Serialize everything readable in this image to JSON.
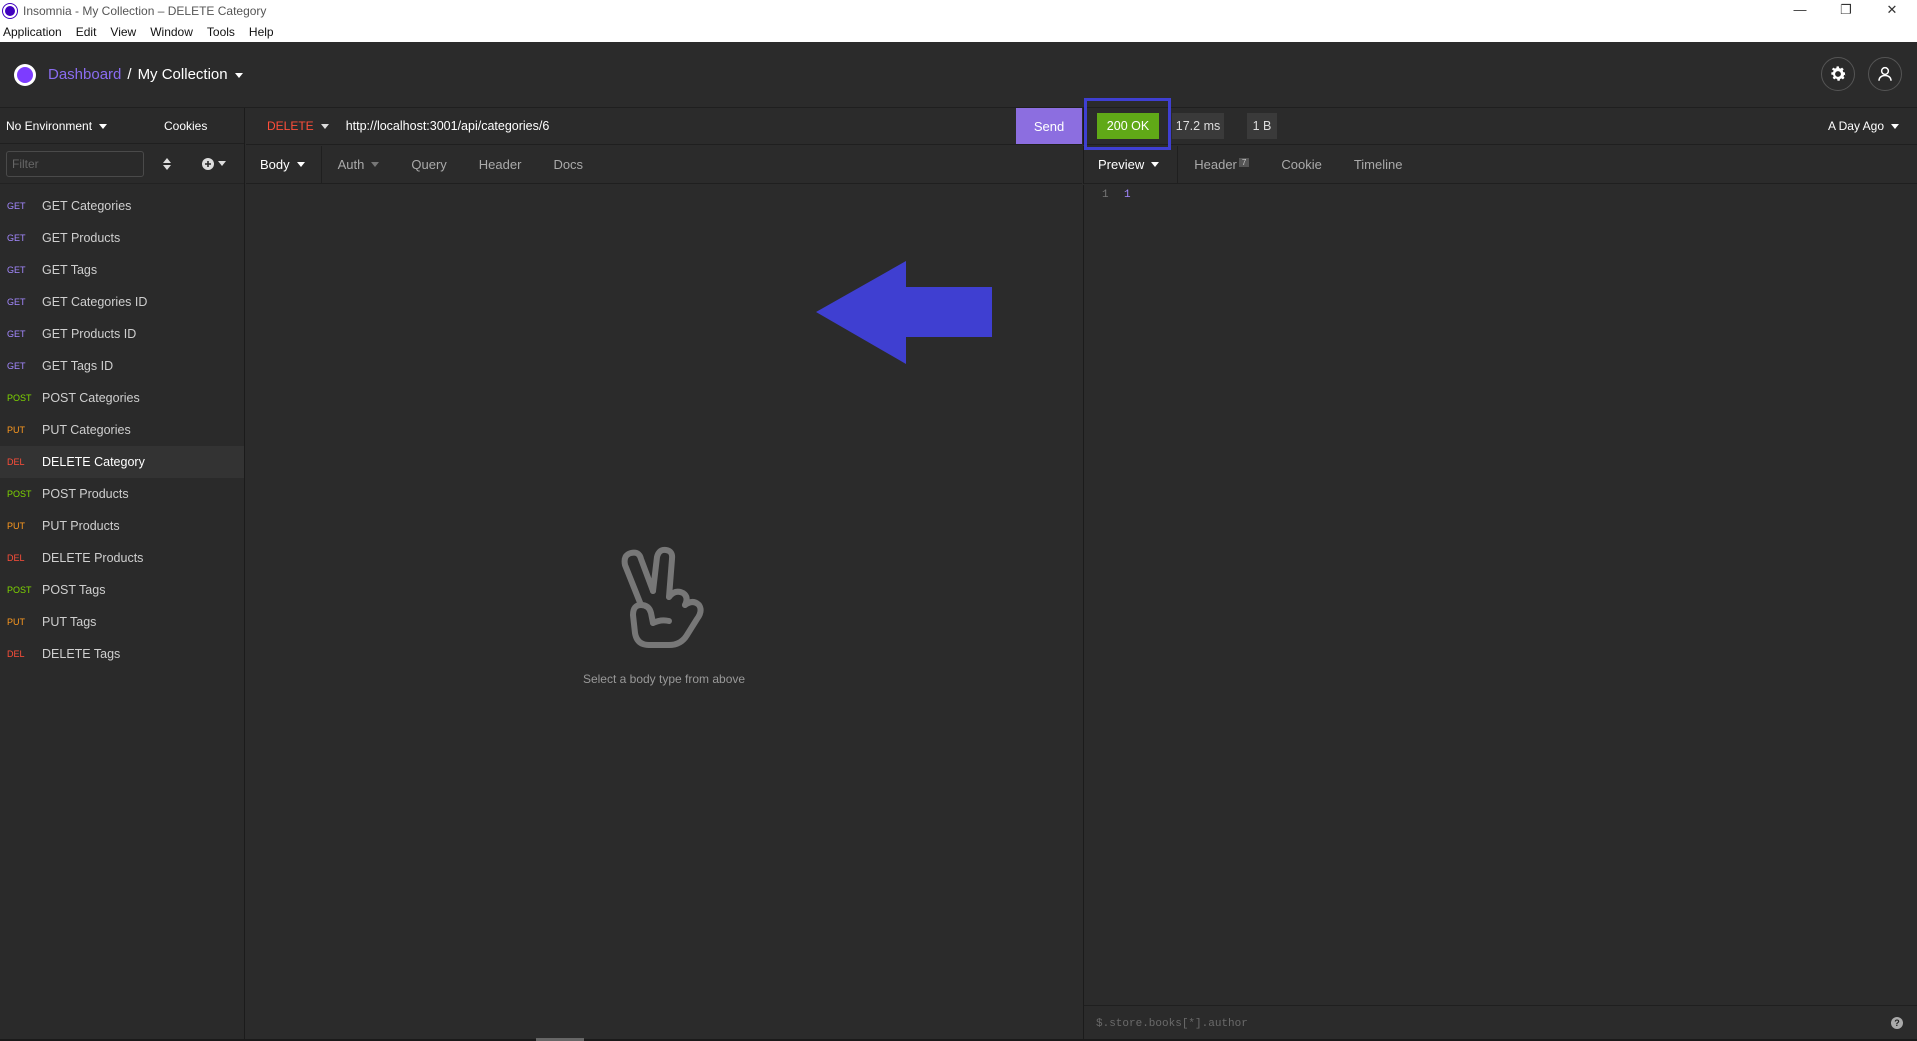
{
  "window": {
    "title": "Insomnia - My Collection – DELETE Category",
    "controls": [
      "—",
      "❐",
      "✕"
    ]
  },
  "menu": [
    "Application",
    "Edit",
    "View",
    "Window",
    "Tools",
    "Help"
  ],
  "header": {
    "breadcrumb_dashboard": "Dashboard",
    "breadcrumb_sep": "/",
    "breadcrumb_collection": "My Collection"
  },
  "sidebar": {
    "environment": "No Environment",
    "cookies": "Cookies",
    "filter_placeholder": "Filter",
    "requests": [
      {
        "method": "GET",
        "name": "GET Categories"
      },
      {
        "method": "GET",
        "name": "GET Products"
      },
      {
        "method": "GET",
        "name": "GET Tags"
      },
      {
        "method": "GET",
        "name": "GET Categories ID"
      },
      {
        "method": "GET",
        "name": "GET Products ID"
      },
      {
        "method": "GET",
        "name": "GET Tags ID"
      },
      {
        "method": "POST",
        "name": "POST Categories"
      },
      {
        "method": "PUT",
        "name": "PUT Categories"
      },
      {
        "method": "DEL",
        "name": "DELETE Category"
      },
      {
        "method": "POST",
        "name": "POST Products"
      },
      {
        "method": "PUT",
        "name": "PUT Products"
      },
      {
        "method": "DEL",
        "name": "DELETE Products"
      },
      {
        "method": "POST",
        "name": "POST Tags"
      },
      {
        "method": "PUT",
        "name": "PUT Tags"
      },
      {
        "method": "DEL",
        "name": "DELETE Tags"
      }
    ]
  },
  "request": {
    "method": "DELETE",
    "url": "http://localhost:3001/api/categories/6",
    "send": "Send",
    "tabs": [
      "Body",
      "Auth",
      "Query",
      "Header",
      "Docs"
    ],
    "empty_message": "Select a body type from above"
  },
  "response": {
    "status": "200 OK",
    "time": "17.2 ms",
    "size": "1 B",
    "history": "A Day Ago",
    "tabs": [
      "Preview",
      "Header",
      "Cookie",
      "Timeline"
    ],
    "header_count": "7",
    "line_number": "1",
    "body_value": "1",
    "filter_placeholder": "$.store.books[*].author",
    "help": "?"
  },
  "colors": {
    "accent": "#8c6ee0",
    "status_ok": "#60a917",
    "annotation": "#3f3fd1",
    "get": "#a388ff",
    "post": "#7fd600",
    "put": "#ff9a1f",
    "delete": "#ff4e3a"
  }
}
